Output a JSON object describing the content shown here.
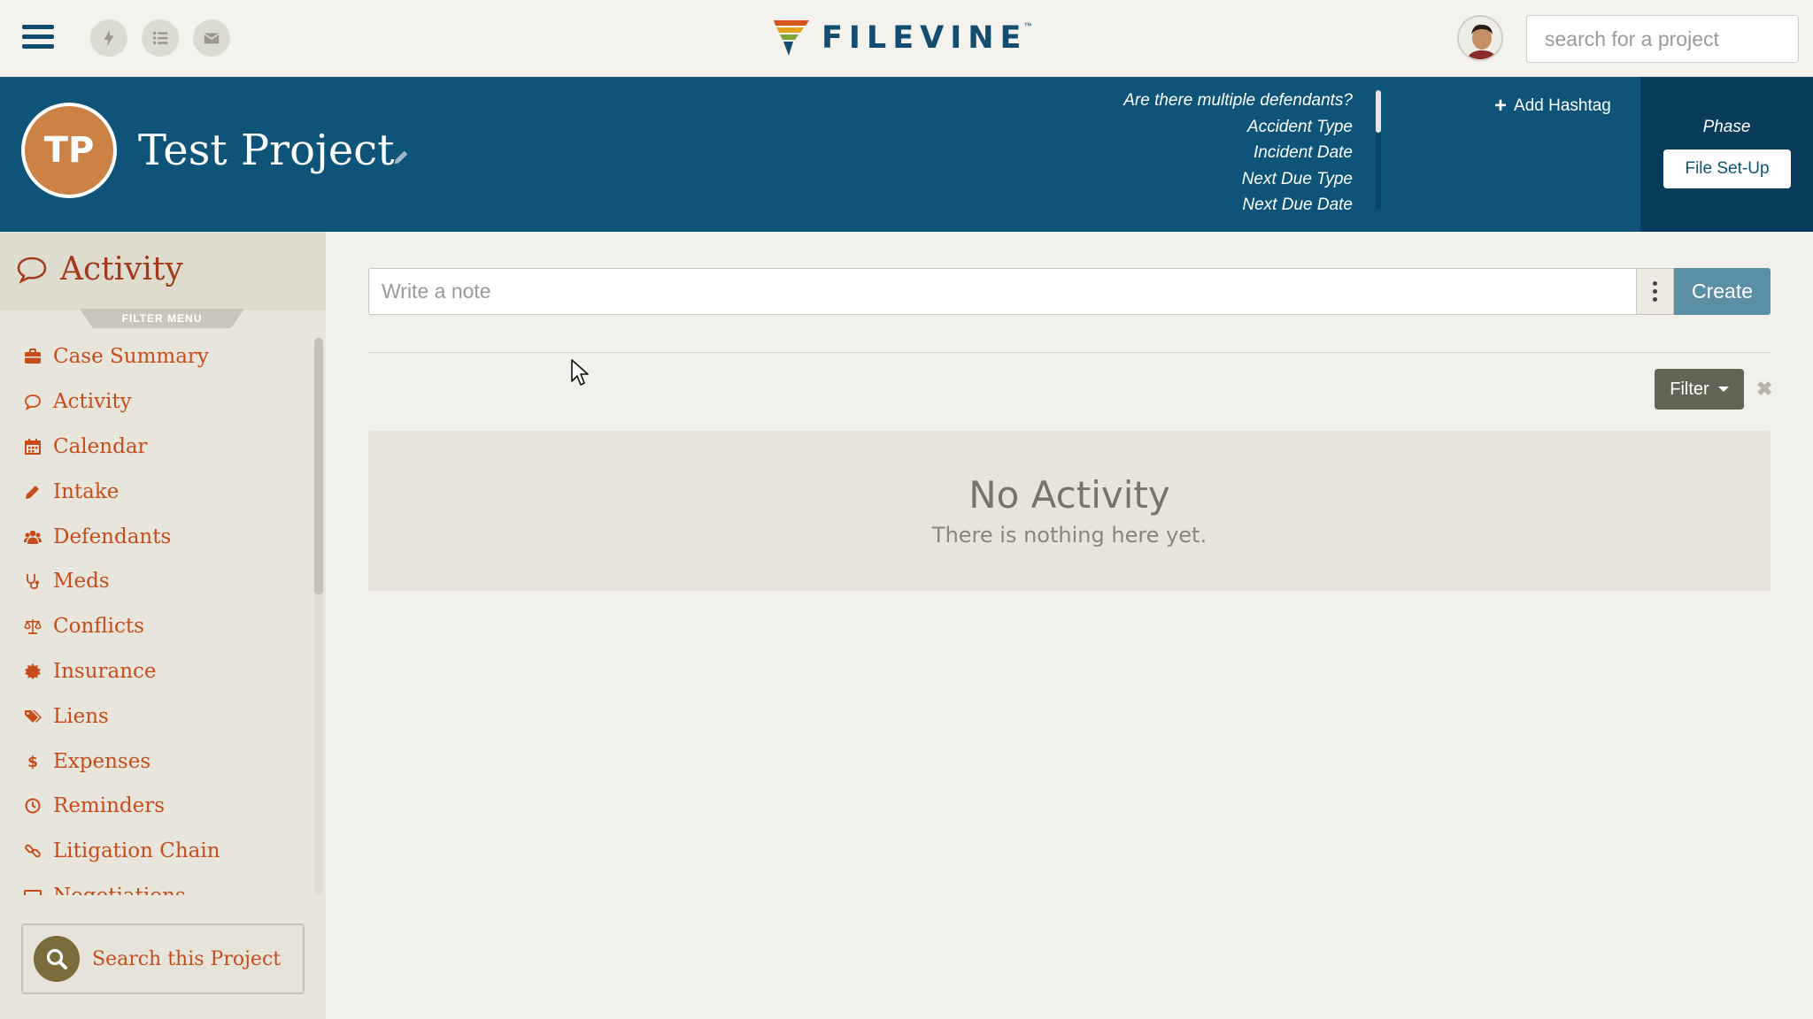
{
  "brand": {
    "logo_text": "FILEVINE",
    "trademark": "™"
  },
  "topnav": {
    "search_placeholder": "search for a project"
  },
  "project": {
    "initials": "TP",
    "name": "Test Project",
    "fields": [
      "Are there multiple defendants?",
      "Accident Type",
      "Incident Date",
      "Next Due Type",
      "Next Due Date"
    ],
    "add_hashtag_label": "Add Hashtag",
    "phase_label": "Phase",
    "phase_value": "File Set-Up"
  },
  "sidebar": {
    "title": "Activity",
    "filter_menu_label": "FILTER MENU",
    "items": [
      {
        "label": "Case Summary",
        "icon": "briefcase-icon"
      },
      {
        "label": "Activity",
        "icon": "speech-bubble-icon"
      },
      {
        "label": "Calendar",
        "icon": "calendar-icon"
      },
      {
        "label": "Intake",
        "icon": "pencil-icon"
      },
      {
        "label": "Defendants",
        "icon": "users-icon"
      },
      {
        "label": "Meds",
        "icon": "stethoscope-icon"
      },
      {
        "label": "Conflicts",
        "icon": "scale-icon"
      },
      {
        "label": "Insurance",
        "icon": "certificate-icon"
      },
      {
        "label": "Liens",
        "icon": "tags-icon"
      },
      {
        "label": "Expenses",
        "icon": "dollar-icon"
      },
      {
        "label": "Reminders",
        "icon": "clock-icon"
      },
      {
        "label": "Litigation Chain",
        "icon": "link-icon"
      },
      {
        "label": "Negotiations",
        "icon": "handshake-icon"
      }
    ],
    "search_project_label": "Search this Project"
  },
  "main": {
    "note_placeholder": "Write a note",
    "create_label": "Create",
    "filter_label": "Filter",
    "clear_label": "✖",
    "empty_title": "No Activity",
    "empty_subtitle": "There is nothing here yet."
  },
  "colors": {
    "header_blue": "#0d5478",
    "phase_panel": "#083c5a",
    "accent_orange": "#c74c1c",
    "avatar_orange": "#cc8245",
    "create_blue": "#5a8fa6",
    "filter_olive": "#646455"
  }
}
